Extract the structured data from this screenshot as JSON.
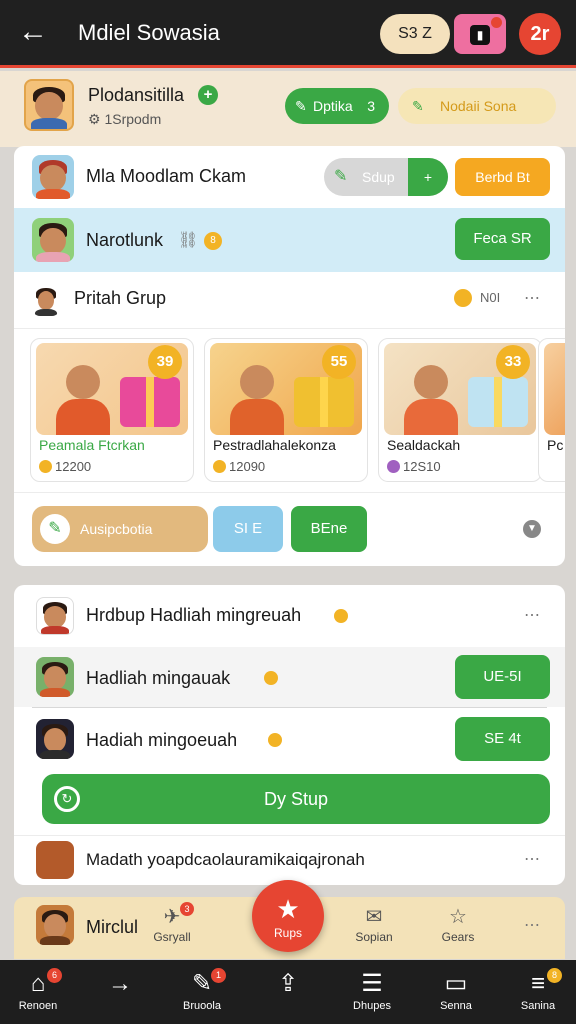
{
  "header": {
    "title": "Mdiel Sowasia",
    "pill_text": "S3 Z",
    "pink_badge": "?",
    "profile_badge": "2r"
  },
  "profile": {
    "name": "Plodansitilla",
    "subtitle": "1Srpodm",
    "btn_green": "Dptika",
    "btn_green_count": "3",
    "btn_cream": "Nodaii Sona"
  },
  "panel": {
    "row1": {
      "label": "Mla Moodlam Ckam",
      "toggle_label": "Sdup",
      "toggle_right": "+",
      "btn": "Berbd Bt"
    },
    "row2": {
      "label": "Narotlunk",
      "suffix": "8",
      "btn": "Feca SR"
    },
    "row3": {
      "label": "Pritah Grup",
      "value": "N0I"
    },
    "gifts": [
      {
        "name": "Peamala Ftcrkan",
        "price": "12200",
        "badge": "39"
      },
      {
        "name": "Pestradlahalekonza",
        "price": "12090",
        "badge": "55"
      },
      {
        "name": "Sealdackah",
        "price": "12S10",
        "badge": "33"
      },
      {
        "name": "Pc",
        "price": "",
        "badge": ""
      }
    ],
    "action_tan": "Ausipcbotia",
    "action_blue": "SI E",
    "action_green": "BEne"
  },
  "panel2": {
    "header": "Hrdbup Hadliah mingreuah",
    "rows": [
      {
        "label": "Hadliah mingauak",
        "btn": "UE-5I"
      },
      {
        "label": "Hadiah mingoeuah",
        "btn": "SE 4t"
      }
    ],
    "big_button": "Dy Stup",
    "footer": "Madath yoapdcaolauramikaiqajronah"
  },
  "quick": {
    "label": "Mirclul",
    "items": [
      {
        "label": "Gsryall",
        "badge": "3"
      },
      {
        "label": "Rups"
      },
      {
        "label": "Sopian"
      },
      {
        "label": "Gears"
      }
    ]
  },
  "bottom_nav": [
    {
      "label": "Renoen",
      "icon": "home-icon",
      "badge": "6"
    },
    {
      "label": "",
      "icon": "arrow-icon"
    },
    {
      "label": "Bruoola",
      "icon": "leaf-icon",
      "badge": "1"
    },
    {
      "label": "",
      "icon": "share-icon"
    },
    {
      "label": "Dhupes",
      "icon": "list-icon"
    },
    {
      "label": "Senna",
      "icon": "window-icon"
    },
    {
      "label": "Sanina",
      "icon": "menu-icon",
      "badge": "8"
    }
  ],
  "colors": {
    "accent": "#e64532",
    "green": "#3aa845",
    "orange": "#f5a821",
    "cream": "#f3e7d4"
  }
}
